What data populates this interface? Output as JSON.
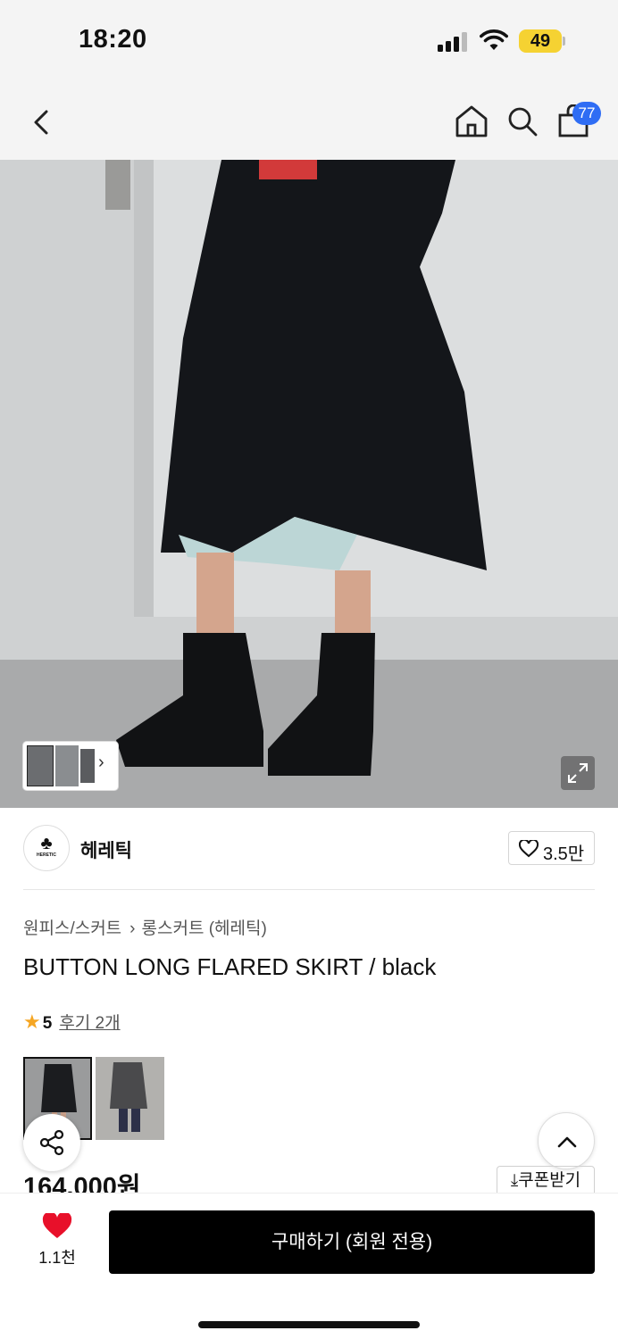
{
  "status_bar": {
    "time": "18:20",
    "battery": "49"
  },
  "header": {
    "cart_count": "77"
  },
  "brand": {
    "name": "헤레틱",
    "logo_text": "HERETIC",
    "likes": "3.5만"
  },
  "breadcrumb": {
    "parent": "원피스/스커트",
    "child": "롱스커트 (헤레틱)"
  },
  "product": {
    "title": "BUTTON LONG FLARED SKIRT / black",
    "rating": "5",
    "reviews": "후기 2개",
    "price": "164,000원"
  },
  "actions": {
    "coupon": "쿠폰받기",
    "wish_count": "1.1천",
    "buy_label": "구매하기 (회원 전용)"
  },
  "colors": {
    "accent_blue": "#2f6df4",
    "heart_red": "#e8102a",
    "star": "#f5a623"
  }
}
